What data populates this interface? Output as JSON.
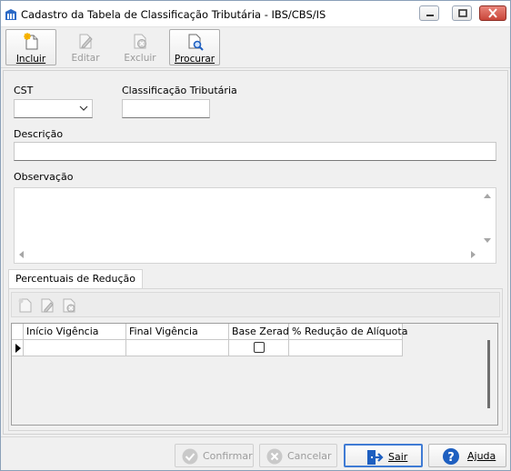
{
  "window": {
    "title": "Cadastro da Tabela de Classificação Tributária - IBS/CBS/IS"
  },
  "toolbar": {
    "incluir": "Incluir",
    "editar": "Editar",
    "excluir": "Excluir",
    "procurar": "Procurar"
  },
  "form": {
    "cst_label": "CST",
    "cst_value": "",
    "classificacao_label": "Classificação Tributária",
    "classificacao_value": "",
    "descricao_label": "Descrição",
    "descricao_value": "",
    "observacao_label": "Observação",
    "observacao_value": ""
  },
  "tabs": {
    "percentuais": "Percentuais de Redução"
  },
  "grid": {
    "columns": [
      "Início Vigência",
      "Final Vigência",
      "Base Zerada",
      "% Redução de Alíquota"
    ],
    "rows": [
      {
        "inicio": "",
        "final": "",
        "base_zerada": false,
        "reducao": ""
      }
    ]
  },
  "buttons": {
    "confirmar": "Confirmar",
    "cancelar": "Cancelar",
    "sair": "Sair",
    "ajuda": "Ajuda"
  },
  "colors": {
    "accent": "#3f7bd4",
    "close": "#c9463a"
  }
}
